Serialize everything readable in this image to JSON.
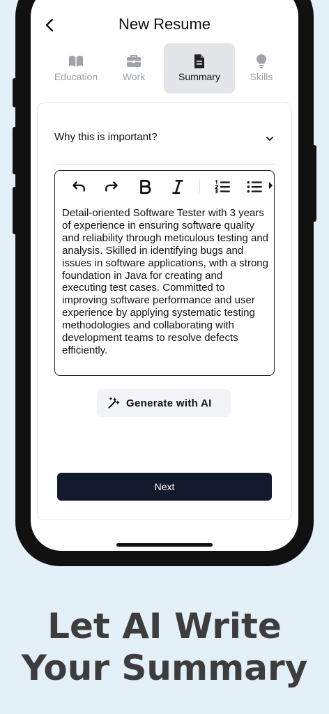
{
  "header": {
    "title": "New Resume",
    "back_icon": "chevron-left-icon"
  },
  "tabs": [
    {
      "label": "Education",
      "icon": "book-icon",
      "active": false
    },
    {
      "label": "Work",
      "icon": "briefcase-icon",
      "active": false
    },
    {
      "label": "Summary",
      "icon": "document-icon",
      "active": true
    },
    {
      "label": "Skills",
      "icon": "lightbulb-icon",
      "active": false
    }
  ],
  "card": {
    "accordion_title": "Why this is important?",
    "editor": {
      "toolbar": [
        "undo-icon",
        "redo-icon",
        "bold-icon",
        "italic-icon",
        "ordered-list-icon",
        "bullet-list-icon"
      ],
      "text": "Detail-oriented Software Tester with 3 years of experience in ensuring software quality and reliability through meticulous testing and analysis. Skilled in identifying bugs and issues in software applications, with a strong foundation in Java for creating and executing test cases. Committed to improving software performance and user experience by applying systematic testing methodologies and collaborating with development teams to resolve defects efficiently."
    },
    "generate_label": "Generate with AI",
    "next_label": "Next"
  },
  "promo": {
    "line1": "Let AI Write",
    "line2": "Your Summary"
  },
  "colors": {
    "background": "#e4f0f7",
    "primary_button": "#131a2b",
    "active_tab": "#e3e5e8",
    "inactive_text": "#9aa0a6"
  }
}
